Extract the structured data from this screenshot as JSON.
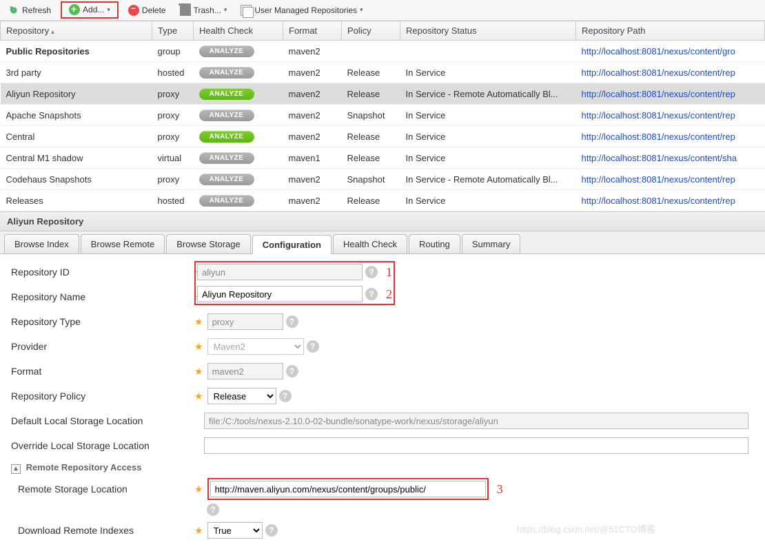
{
  "toolbar": {
    "refresh": "Refresh",
    "add": "Add...",
    "delete": "Delete",
    "trash": "Trash...",
    "user_managed": "User Managed Repositories"
  },
  "columns": {
    "repository": "Repository",
    "type": "Type",
    "health": "Health Check",
    "format": "Format",
    "policy": "Policy",
    "status": "Repository Status",
    "path": "Repository Path"
  },
  "analyze_label": "ANALYZE",
  "rows": [
    {
      "name": "Public Repositories",
      "type": "group",
      "green": false,
      "format": "maven2",
      "policy": "",
      "status": "",
      "path": "http://localhost:8081/nexus/content/gro",
      "selected": false
    },
    {
      "name": "3rd party",
      "type": "hosted",
      "green": false,
      "format": "maven2",
      "policy": "Release",
      "status": "In Service",
      "path": "http://localhost:8081/nexus/content/rep",
      "selected": false
    },
    {
      "name": "Aliyun Repository",
      "type": "proxy",
      "green": true,
      "format": "maven2",
      "policy": "Release",
      "status": "In Service - Remote Automatically Bl...",
      "path": "http://localhost:8081/nexus/content/rep",
      "selected": true
    },
    {
      "name": "Apache Snapshots",
      "type": "proxy",
      "green": false,
      "format": "maven2",
      "policy": "Snapshot",
      "status": "In Service",
      "path": "http://localhost:8081/nexus/content/rep",
      "selected": false
    },
    {
      "name": "Central",
      "type": "proxy",
      "green": true,
      "format": "maven2",
      "policy": "Release",
      "status": "In Service",
      "path": "http://localhost:8081/nexus/content/rep",
      "selected": false
    },
    {
      "name": "Central M1 shadow",
      "type": "virtual",
      "green": false,
      "format": "maven1",
      "policy": "Release",
      "status": "In Service",
      "path": "http://localhost:8081/nexus/content/sha",
      "selected": false
    },
    {
      "name": "Codehaus Snapshots",
      "type": "proxy",
      "green": false,
      "format": "maven2",
      "policy": "Snapshot",
      "status": "In Service - Remote Automatically Bl...",
      "path": "http://localhost:8081/nexus/content/rep",
      "selected": false
    },
    {
      "name": "Releases",
      "type": "hosted",
      "green": false,
      "format": "maven2",
      "policy": "Release",
      "status": "In Service",
      "path": "http://localhost:8081/nexus/content/rep",
      "selected": false
    }
  ],
  "panel": {
    "title": "Aliyun Repository"
  },
  "tabs": {
    "browse_index": "Browse Index",
    "browse_remote": "Browse Remote",
    "browse_storage": "Browse Storage",
    "configuration": "Configuration",
    "health_check": "Health Check",
    "routing": "Routing",
    "summary": "Summary"
  },
  "form": {
    "repo_id_label": "Repository ID",
    "repo_id": "aliyun",
    "repo_name_label": "Repository Name",
    "repo_name": "Aliyun Repository",
    "repo_type_label": "Repository Type",
    "repo_type": "proxy",
    "provider_label": "Provider",
    "provider": "Maven2",
    "format_label": "Format",
    "format": "maven2",
    "policy_label": "Repository Policy",
    "policy": "Release",
    "default_local_label": "Default Local Storage Location",
    "default_local": "file:/C:/tools/nexus-2.10.0-02-bundle/sonatype-work/nexus/storage/aliyun",
    "override_local_label": "Override Local Storage Location",
    "override_local": "",
    "remote_section": "Remote Repository Access",
    "remote_location_label": "Remote Storage Location",
    "remote_location": "http://maven.aliyun.com/nexus/content/groups/public/",
    "download_indexes_label": "Download Remote Indexes",
    "download_indexes": "True"
  },
  "annotations": {
    "a1": "1",
    "a2": "2",
    "a3": "3"
  },
  "watermark": "https://blog.csdn.net/@51CTO博客"
}
